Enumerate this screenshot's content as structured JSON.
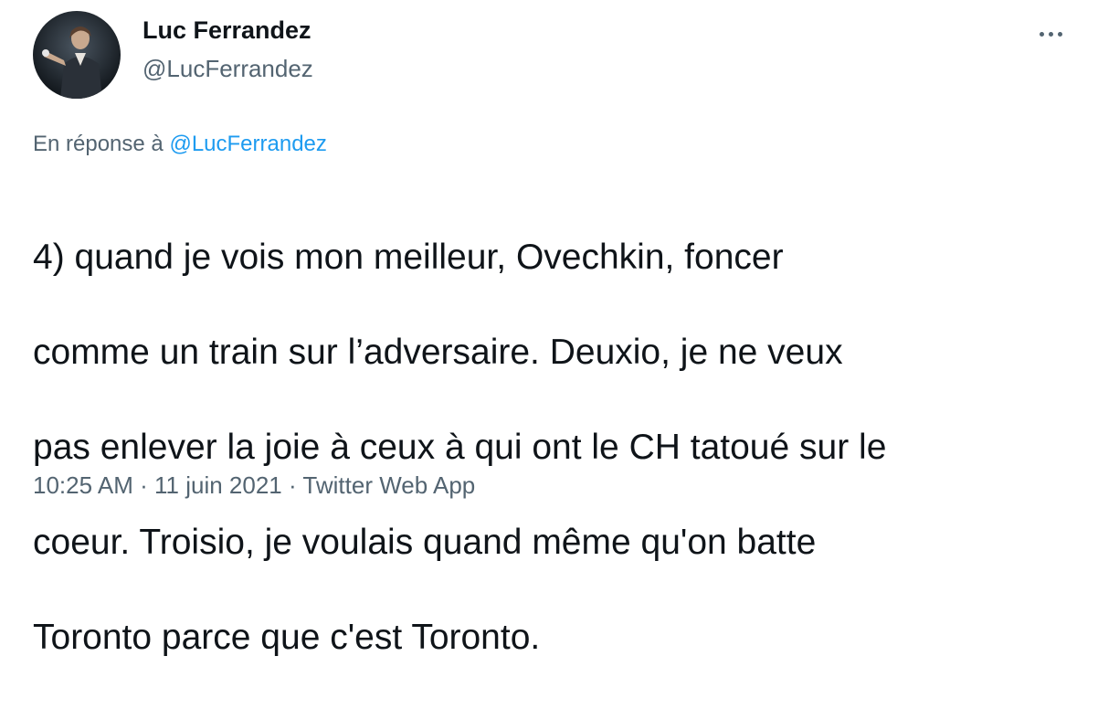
{
  "author": {
    "display_name": "Luc Ferrandez",
    "handle": "@LucFerrandez",
    "avatar_icon": "profile-photo"
  },
  "more_icon": "more-horizontal-icon",
  "reply_context": {
    "prefix": "En réponse à",
    "mention": "@LucFerrandez"
  },
  "tweet": {
    "lines": [
      "4) quand je vois mon meilleur, Ovechkin, foncer",
      "comme un train sur l’adversaire. Deuxio, je ne veux",
      "pas enlever la joie à ceux à qui ont le CH tatoué sur le",
      "coeur. Troisio, je voulais quand même qu'on batte",
      "Toronto parce que c'est Toronto."
    ]
  },
  "meta": {
    "time": "10:25 AM",
    "separator": "·",
    "date": "11 juin 2021",
    "source": "Twitter Web App"
  },
  "colors": {
    "text_primary": "#0f1419",
    "text_secondary": "#536471",
    "link_blue": "#1d9bf0"
  }
}
